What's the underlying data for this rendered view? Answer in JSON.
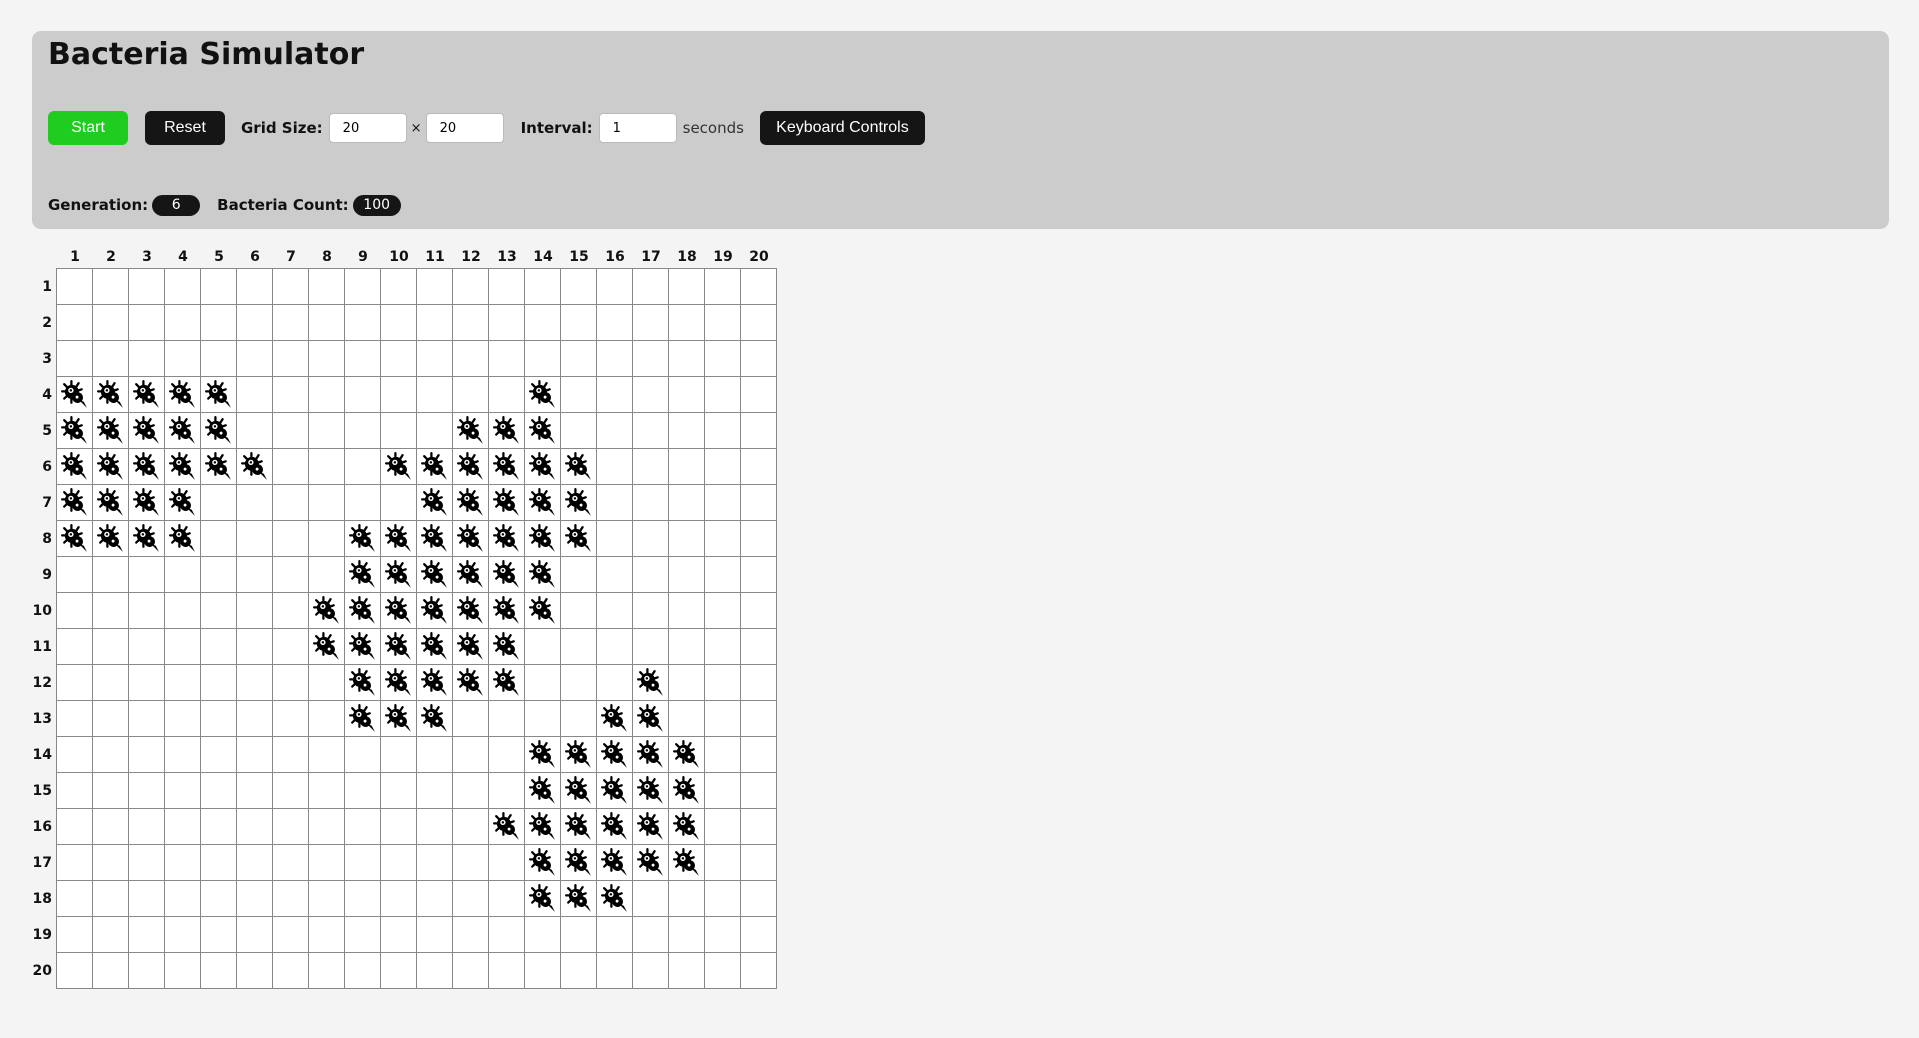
{
  "header": {
    "title": "Bacteria Simulator"
  },
  "controls": {
    "start_label": "Start",
    "reset_label": "Reset",
    "grid_size_label": "Grid Size:",
    "grid_width": "20",
    "times_symbol": "×",
    "grid_height": "20",
    "interval_label": "Interval:",
    "interval_value": "1",
    "interval_unit": "seconds",
    "keyboard_label": "Keyboard Controls",
    "start_color": "#1fcc1f",
    "button_color": "#151515"
  },
  "stats": {
    "generation_label": "Generation:",
    "generation_value": "6",
    "count_label": "Bacteria Count:",
    "count_value": "100"
  },
  "grid": {
    "rows": 20,
    "cols": 20,
    "column_labels": [
      "1",
      "2",
      "3",
      "4",
      "5",
      "6",
      "7",
      "8",
      "9",
      "10",
      "11",
      "12",
      "13",
      "14",
      "15",
      "16",
      "17",
      "18",
      "19",
      "20"
    ],
    "row_labels": [
      "1",
      "2",
      "3",
      "4",
      "5",
      "6",
      "7",
      "8",
      "9",
      "10",
      "11",
      "12",
      "13",
      "14",
      "15",
      "16",
      "17",
      "18",
      "19",
      "20"
    ],
    "cell_icon": "bacterium-icon",
    "occupied": [
      [
        4,
        1
      ],
      [
        4,
        2
      ],
      [
        4,
        3
      ],
      [
        4,
        4
      ],
      [
        4,
        5
      ],
      [
        4,
        14
      ],
      [
        5,
        1
      ],
      [
        5,
        2
      ],
      [
        5,
        3
      ],
      [
        5,
        4
      ],
      [
        5,
        5
      ],
      [
        5,
        12
      ],
      [
        5,
        13
      ],
      [
        5,
        14
      ],
      [
        6,
        1
      ],
      [
        6,
        2
      ],
      [
        6,
        3
      ],
      [
        6,
        4
      ],
      [
        6,
        5
      ],
      [
        6,
        6
      ],
      [
        6,
        10
      ],
      [
        6,
        11
      ],
      [
        6,
        12
      ],
      [
        6,
        13
      ],
      [
        6,
        14
      ],
      [
        6,
        15
      ],
      [
        7,
        1
      ],
      [
        7,
        2
      ],
      [
        7,
        3
      ],
      [
        7,
        4
      ],
      [
        7,
        11
      ],
      [
        7,
        12
      ],
      [
        7,
        13
      ],
      [
        7,
        14
      ],
      [
        7,
        15
      ],
      [
        8,
        1
      ],
      [
        8,
        2
      ],
      [
        8,
        3
      ],
      [
        8,
        4
      ],
      [
        8,
        9
      ],
      [
        8,
        10
      ],
      [
        8,
        11
      ],
      [
        8,
        12
      ],
      [
        8,
        13
      ],
      [
        8,
        14
      ],
      [
        8,
        15
      ],
      [
        9,
        9
      ],
      [
        9,
        10
      ],
      [
        9,
        11
      ],
      [
        9,
        12
      ],
      [
        9,
        13
      ],
      [
        9,
        14
      ],
      [
        10,
        8
      ],
      [
        10,
        9
      ],
      [
        10,
        10
      ],
      [
        10,
        11
      ],
      [
        10,
        12
      ],
      [
        10,
        13
      ],
      [
        10,
        14
      ],
      [
        11,
        8
      ],
      [
        11,
        9
      ],
      [
        11,
        10
      ],
      [
        11,
        11
      ],
      [
        11,
        12
      ],
      [
        11,
        13
      ],
      [
        12,
        9
      ],
      [
        12,
        10
      ],
      [
        12,
        11
      ],
      [
        12,
        12
      ],
      [
        12,
        13
      ],
      [
        12,
        17
      ],
      [
        13,
        9
      ],
      [
        13,
        10
      ],
      [
        13,
        11
      ],
      [
        13,
        16
      ],
      [
        13,
        17
      ],
      [
        14,
        14
      ],
      [
        14,
        15
      ],
      [
        14,
        16
      ],
      [
        14,
        17
      ],
      [
        14,
        18
      ],
      [
        15,
        14
      ],
      [
        15,
        15
      ],
      [
        15,
        16
      ],
      [
        15,
        17
      ],
      [
        15,
        18
      ],
      [
        16,
        13
      ],
      [
        16,
        14
      ],
      [
        16,
        15
      ],
      [
        16,
        16
      ],
      [
        16,
        17
      ],
      [
        16,
        18
      ],
      [
        17,
        14
      ],
      [
        17,
        15
      ],
      [
        17,
        16
      ],
      [
        17,
        17
      ],
      [
        17,
        18
      ],
      [
        18,
        14
      ],
      [
        18,
        15
      ],
      [
        18,
        16
      ]
    ]
  }
}
